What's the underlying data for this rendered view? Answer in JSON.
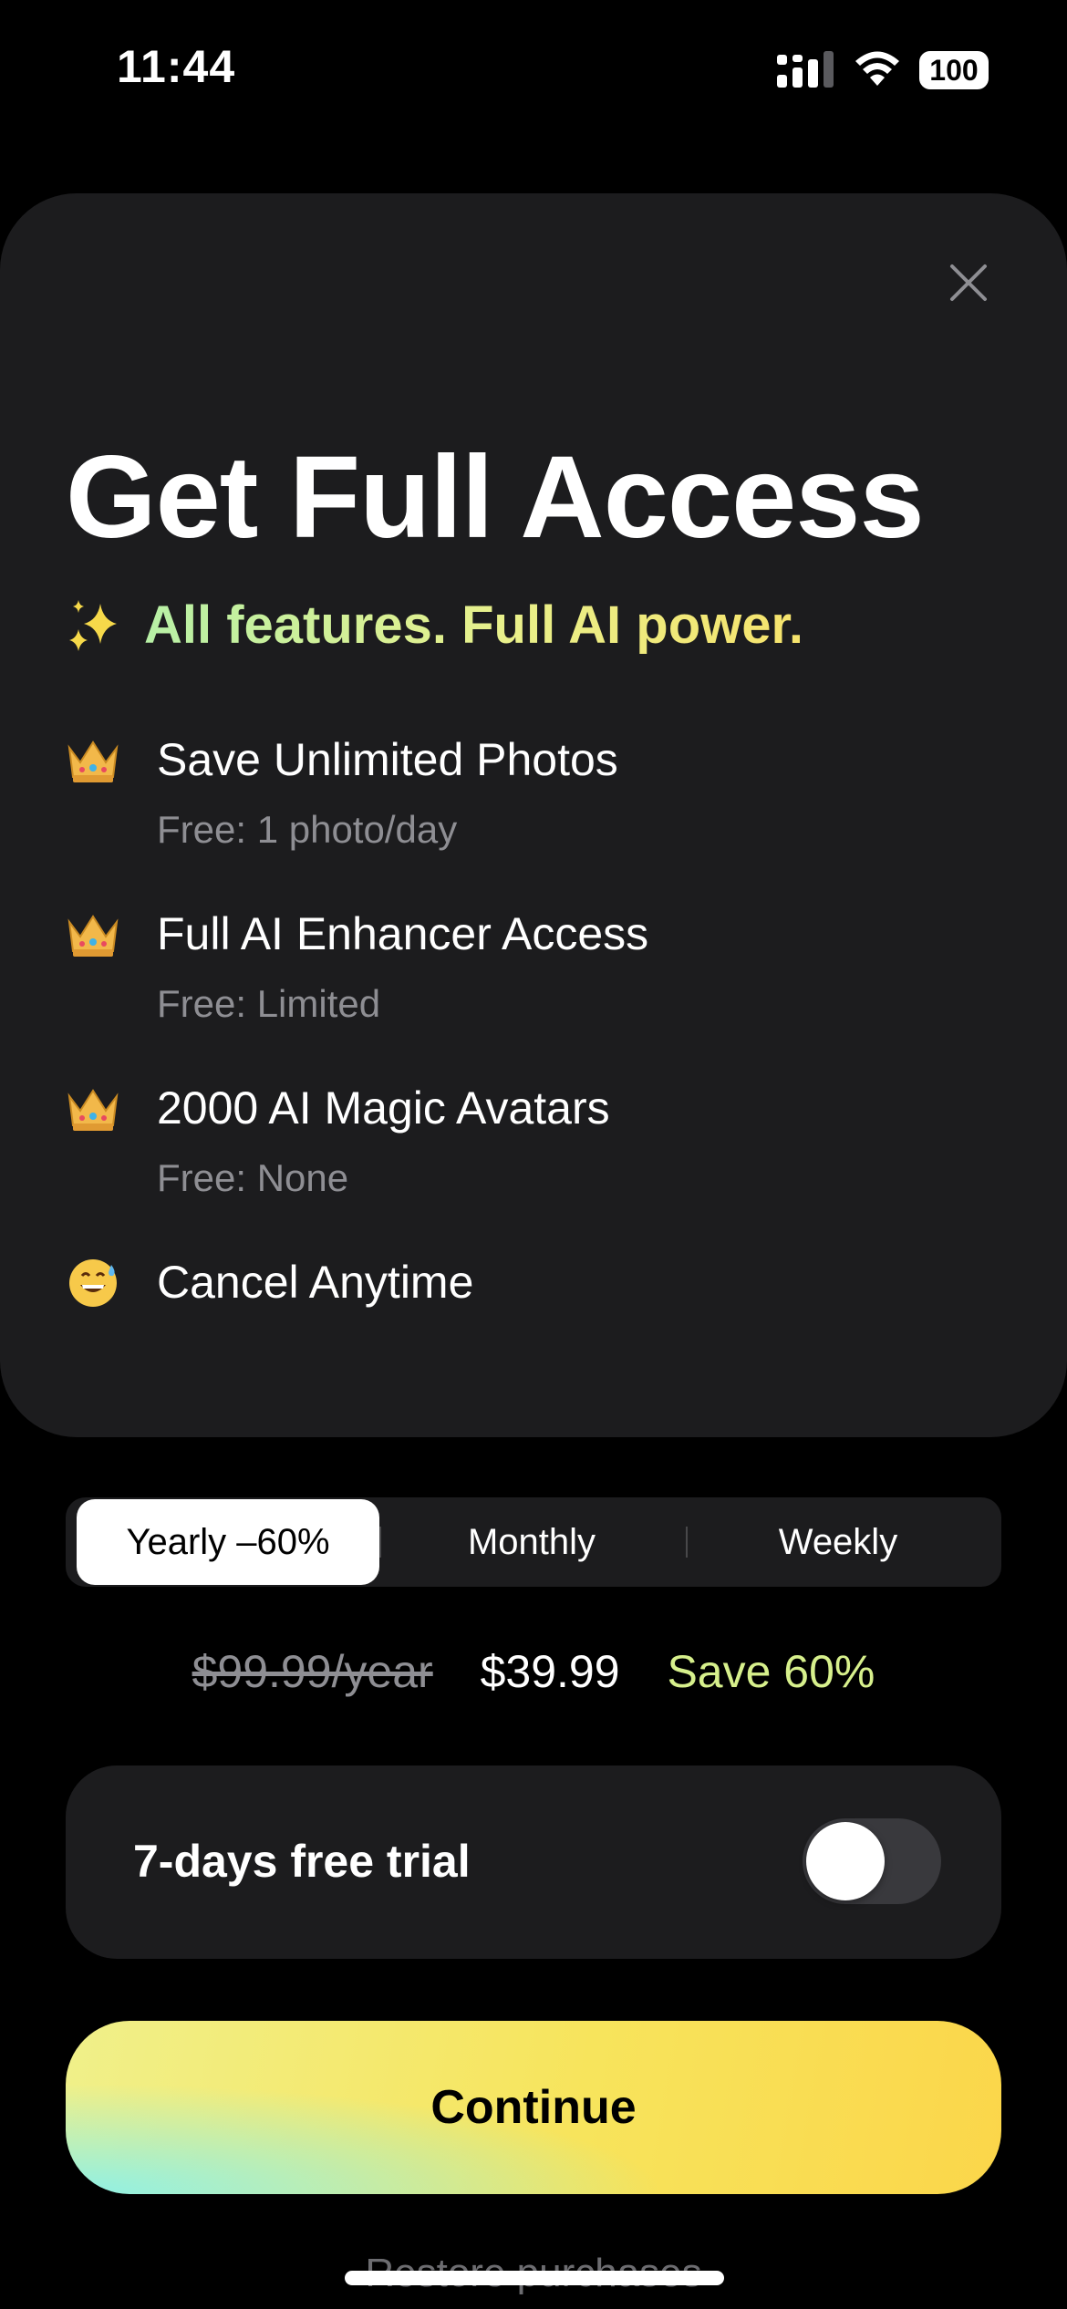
{
  "status_bar": {
    "time": "11:44",
    "battery": "100",
    "icons": [
      "signal-icon",
      "wifi-icon",
      "battery-icon"
    ]
  },
  "paywall": {
    "title": "Get Full Access",
    "subtitle": "All features. Full AI power.",
    "subtitle_icon": "sparkles-icon",
    "close_icon": "close-icon",
    "features": [
      {
        "icon": "crown-icon",
        "title": "Save Unlimited Photos",
        "subtitle": "Free: 1 photo/day"
      },
      {
        "icon": "crown-icon",
        "title": "Full AI Enhancer Access",
        "subtitle": "Free: Limited"
      },
      {
        "icon": "crown-icon",
        "title": "2000 AI Magic Avatars",
        "subtitle": "Free: None"
      },
      {
        "icon": "grinning-sweat-icon",
        "title": "Cancel Anytime"
      }
    ]
  },
  "plans": {
    "selected": "yearly",
    "options": [
      {
        "id": "yearly",
        "label": "Yearly –60%"
      },
      {
        "id": "monthly",
        "label": "Monthly"
      },
      {
        "id": "weekly",
        "label": "Weekly"
      }
    ]
  },
  "pricing": {
    "original": "$99.99/year",
    "current": "$39.99",
    "savings": "Save 60%"
  },
  "trial": {
    "label": "7-days free trial",
    "enabled": false
  },
  "actions": {
    "continue_label": "Continue",
    "restore_label": "Restore purchases"
  },
  "colors": {
    "background": "#000000",
    "card": "#1c1c1e",
    "accent_green": "#b7f0a6",
    "accent_yellow": "#f6e36c",
    "muted_text": "#8e8e93",
    "savings_text": "#d7f08c"
  }
}
